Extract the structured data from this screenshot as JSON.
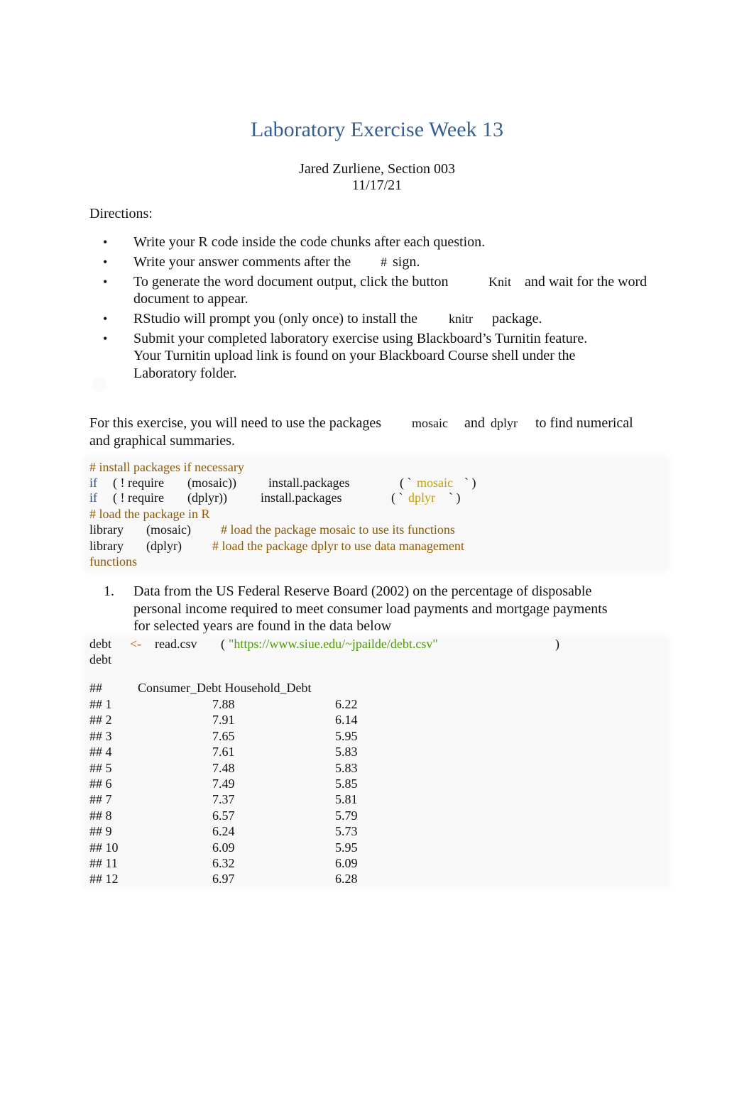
{
  "document": {
    "title": "Laboratory Exercise Week 13",
    "author_line": "Jared Zurliene, Section 003",
    "date": "11/17/21",
    "directions_heading": "Directions:",
    "bullet_glyph": "•",
    "directions": [
      {
        "parts": [
          "Write your R code inside the code chunks after each question."
        ]
      },
      {
        "parts": [
          "Write your answer comments after the",
          "#",
          "sign."
        ]
      },
      {
        "parts": [
          "To generate the word document output, click the button",
          "Knit",
          "and wait for the word",
          "document to appear."
        ]
      },
      {
        "parts": [
          "RStudio will prompt you (only once) to install the",
          "knitr",
          "package."
        ]
      },
      {
        "parts": [
          "Submit your completed laboratory exercise using Blackboard’s Turnitin feature.",
          "Your Turnitin upload link is found on your Blackboard Course shell under the",
          "Laboratory folder."
        ]
      }
    ],
    "intro": {
      "before": "For this exercise, you will need to use the packages",
      "pkg1": "mosaic",
      "mid": "and",
      "pkg2": "dplyr",
      "after": "to find numerical",
      "line2": "and graphical summaries."
    },
    "code_chunk_1": {
      "comment1": "# install packages if necessary",
      "if_kw": "if",
      "line2": {
        "cond": "( ! require",
        "arg": "(mosaic))",
        "fn": "install.packages",
        "open": "( `",
        "str": "mosaic",
        "close": "` )"
      },
      "line3": {
        "cond": "( ! require",
        "arg": "(dplyr))",
        "fn": "install.packages",
        "open": "( `",
        "str": "dplyr",
        "close": "` )"
      },
      "comment2": "# load the package in R",
      "line5": {
        "fn": "library",
        "arg": "(mosaic)",
        "comment": "# load the package mosaic to use its functions"
      },
      "line6": {
        "fn": "library",
        "arg": "(dplyr)",
        "comment": "# load the package dplyr to use data management"
      },
      "line7": "functions"
    },
    "question_1": {
      "number": "1.",
      "lines": [
        "Data from the US Federal Reserve Board (2002) on the percentage of disposable",
        "personal income required to meet consumer load payments and mortgage payments",
        "for selected years are found in the data below"
      ]
    },
    "code_chunk_2": {
      "var": "debt",
      "assign": "<-",
      "fn": "read.csv",
      "open": "(",
      "url": "\"https://www.siue.edu/~jpailde/debt.csv\"",
      "close": ")",
      "line2": "debt"
    },
    "output_table": {
      "prefix": "##",
      "headers": [
        "Consumer_Debt",
        "Household_Debt"
      ],
      "header_line": "Consumer_Debt Household_Debt",
      "rows": [
        {
          "label": "## 1",
          "consumer": "7.88",
          "household": "6.22"
        },
        {
          "label": "## 2",
          "consumer": "7.91",
          "household": "6.14"
        },
        {
          "label": "## 3",
          "consumer": "7.65",
          "household": "5.95"
        },
        {
          "label": "## 4",
          "consumer": "7.61",
          "household": "5.83"
        },
        {
          "label": "## 5",
          "consumer": "7.48",
          "household": "5.83"
        },
        {
          "label": "## 6",
          "consumer": "7.49",
          "household": "5.85"
        },
        {
          "label": "## 7",
          "consumer": "7.37",
          "household": "5.81"
        },
        {
          "label": "## 8",
          "consumer": "6.57",
          "household": "5.79"
        },
        {
          "label": "## 9",
          "consumer": "6.24",
          "household": "5.73"
        },
        {
          "label": "## 10",
          "consumer": "6.09",
          "household": "5.95"
        },
        {
          "label": "## 11",
          "consumer": "6.32",
          "household": "6.09"
        },
        {
          "label": "## 12",
          "consumer": "6.97",
          "household": "6.28"
        }
      ]
    }
  },
  "colors": {
    "title": "#365f91",
    "keyword": "#2b4e7f",
    "comment": "#8f5902",
    "string_backtick": "#c4a000",
    "string_url": "#4e9a06",
    "assign_op": "#ce5c00",
    "code_bg": "#f8f8f8"
  }
}
